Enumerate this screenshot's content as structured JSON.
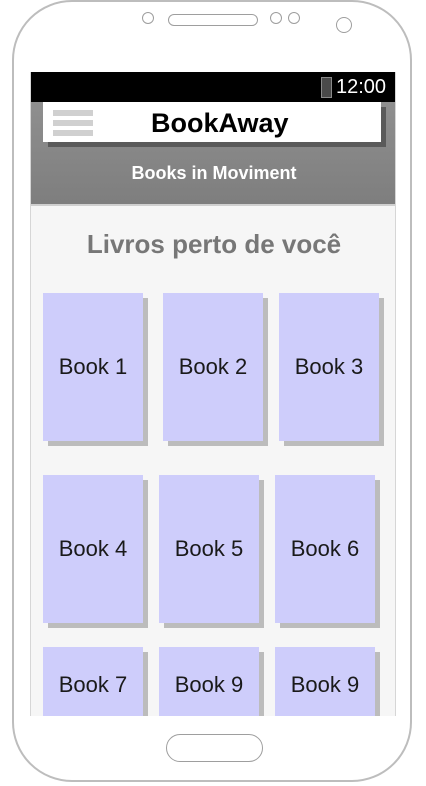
{
  "status_bar": {
    "time": "12:00",
    "battery_icon": "battery-icon"
  },
  "app": {
    "title": "BookAway",
    "menu_icon": "hamburger-menu-icon",
    "subtitle": "Books in Moviment"
  },
  "main": {
    "heading": "Livros perto de você",
    "books": [
      {
        "label": "Book 1"
      },
      {
        "label": "Book 2"
      },
      {
        "label": "Book 3"
      },
      {
        "label": "Book 4"
      },
      {
        "label": "Book 5"
      },
      {
        "label": "Book 6"
      },
      {
        "label": "Book 7"
      },
      {
        "label": "Book 9"
      },
      {
        "label": "Book 9"
      }
    ]
  },
  "colors": {
    "book_tile": "#cecdfb",
    "header_bar": "#888888",
    "heading_text": "#777777",
    "status_bar": "#000000"
  }
}
